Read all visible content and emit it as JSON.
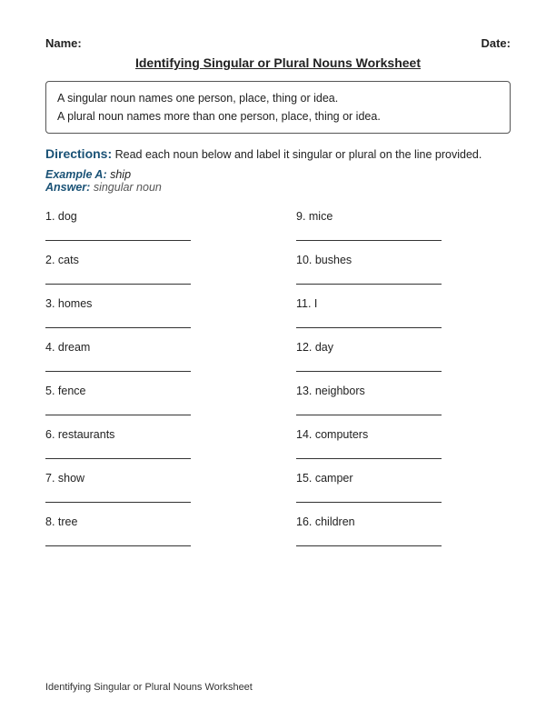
{
  "header": {
    "name_label": "Name:",
    "date_label": "Date:"
  },
  "title": "Identifying Singular or Plural Nouns Worksheet",
  "info_box": {
    "line1": "A singular noun names one person, place, thing or idea.",
    "line2": "A plural noun names more than one person, place, thing or idea."
  },
  "directions": {
    "label": "Directions:",
    "text": "Read each noun below and label it singular or plural on the line provided."
  },
  "example": {
    "label": "Example A:",
    "word": "ship",
    "answer_label": "Answer:",
    "answer_text": "singular noun"
  },
  "nouns": {
    "left": [
      {
        "num": "1.",
        "word": "dog"
      },
      {
        "num": "2.",
        "word": "cats"
      },
      {
        "num": "3.",
        "word": "homes"
      },
      {
        "num": "4.",
        "word": "dream"
      },
      {
        "num": "5.",
        "word": "fence"
      },
      {
        "num": "6.",
        "word": "restaurants"
      },
      {
        "num": "7.",
        "word": "show"
      },
      {
        "num": "8.",
        "word": "tree"
      }
    ],
    "right": [
      {
        "num": "9.",
        "word": "mice"
      },
      {
        "num": "10.",
        "word": "bushes"
      },
      {
        "num": "11.",
        "word": "I"
      },
      {
        "num": "12.",
        "word": "day"
      },
      {
        "num": "13.",
        "word": "neighbors"
      },
      {
        "num": "14.",
        "word": "computers"
      },
      {
        "num": "15.",
        "word": "camper"
      },
      {
        "num": "16.",
        "word": "children"
      }
    ]
  },
  "footer": "Identifying Singular or Plural Nouns Worksheet"
}
